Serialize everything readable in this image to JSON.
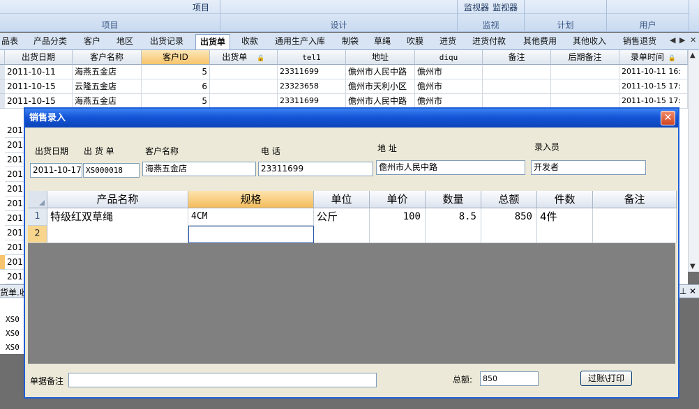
{
  "ribbon": {
    "groups": [
      {
        "label": "项目",
        "buttons": [
          "项目"
        ]
      },
      {
        "label": "设计",
        "buttons": []
      },
      {
        "label": "监视",
        "buttons": [
          "监视器",
          "监视器"
        ]
      },
      {
        "label": "计划",
        "buttons": []
      },
      {
        "label": "用户",
        "buttons": []
      }
    ]
  },
  "tabs": [
    "品表",
    "产品分类",
    "客户",
    "地区",
    "出货记录",
    "出货单",
    "收款",
    "通用生产入库",
    "制袋",
    "草绳",
    "吹膜",
    "进货",
    "进货付款",
    "其他费用",
    "其他收入",
    "销售退货"
  ],
  "active_tab": "出货单",
  "bg_grid": {
    "headers": [
      "出货日期",
      "客户名称",
      "客户ID",
      "出货单",
      "tel1",
      "地址",
      "diqu",
      "备注",
      "后期备注",
      "录单时间"
    ],
    "rows": [
      [
        "2011-10-11",
        "海燕五金店",
        "5",
        "",
        "23311699",
        "儋州市人民中路",
        "儋州市",
        "",
        "",
        "2011-10-11 16:"
      ],
      [
        "2011-10-15",
        "云隆五金店",
        "6",
        "",
        "23323658",
        "儋州市天利小区",
        "儋州市",
        "",
        "",
        "2011-10-15 17:"
      ],
      [
        "2011-10-15",
        "海燕五金店",
        "5",
        "",
        "23311699",
        "儋州市人民中路",
        "儋州市",
        "",
        "",
        "2011-10-15 17:"
      ]
    ],
    "left_fragments": [
      "201",
      "201",
      "201",
      "201",
      "201",
      "201",
      "201",
      "201",
      "201",
      "201",
      "201"
    ]
  },
  "panel2": {
    "title": "货单.收",
    "rows": [
      "XS0",
      "XS0",
      "XS0"
    ]
  },
  "modal": {
    "title": "销售录入",
    "fields": {
      "date_label": "出货日期",
      "date_value": "2011-10-17",
      "order_label": "出 货 单",
      "order_value": "XS000018",
      "customer_label": "客户名称",
      "customer_value": "海燕五金店",
      "phone_label": "电  话",
      "phone_value": "23311699",
      "address_label": "地  址",
      "address_value": "儋州市人民中路",
      "operator_label": "录入员",
      "operator_value": "开发者"
    },
    "grid": {
      "headers": [
        "产品名称",
        "规格",
        "单位",
        "单价",
        "数量",
        "总额",
        "件数",
        "备注"
      ],
      "rows": [
        {
          "num": "1",
          "cells": [
            "特级红双草绳",
            "4CM",
            "公斤",
            "100",
            "8.5",
            "850",
            "4件",
            ""
          ]
        },
        {
          "num": "2",
          "cells": [
            "",
            "",
            "",
            "",
            "",
            "",
            "",
            ""
          ]
        }
      ]
    },
    "note_label": "单据备注",
    "note_value": "",
    "total_label": "总额:",
    "total_value": "850",
    "print_button": "过账\\打印"
  }
}
